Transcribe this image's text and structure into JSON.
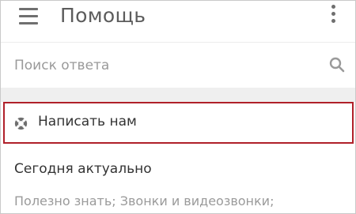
{
  "header": {
    "title": "Помощь",
    "menu_icon": "hamburger-menu-icon",
    "more_icon": "more-vertical-icon"
  },
  "search": {
    "placeholder": "Поиск ответа",
    "icon": "search-icon"
  },
  "contact": {
    "label": "Написать нам",
    "icon": "lifebuoy-icon",
    "highlight_color": "#b0202a"
  },
  "section": {
    "title": "Сегодня актуально",
    "links_text": "Полезно знать;  Звонки и видеозвонки;"
  }
}
